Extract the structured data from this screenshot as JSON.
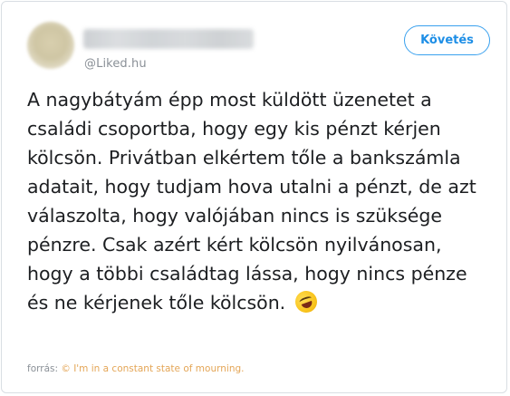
{
  "tweet": {
    "author_handle": "@Liked.hu",
    "follow_label": "Követés",
    "text": "A nagybátyám épp most küldött üzenetet a\ncsaládi csoportba, hogy egy kis pénzt kérjen\nkölcsön. Privátban elkértem tőle a bankszámla\nadatait, hogy tudjam hova utalni a pénzt, de azt\nválaszolta, hogy valójában nincs is szüksége\npénzre. Csak azért kért kölcsön nyilvánosan,\nhogy a többi családtag lássa, hogy nincs pénze\nés ne kérjenek tőle kölcsön.",
    "emoji_icon": "rolling-on-the-floor-laughing-icon"
  },
  "source": {
    "prefix": "forrás:",
    "link_text": "© I'm in a constant state of mourning."
  },
  "colors": {
    "follow_accent": "#1d8ee6",
    "source_link": "#e4a657"
  }
}
